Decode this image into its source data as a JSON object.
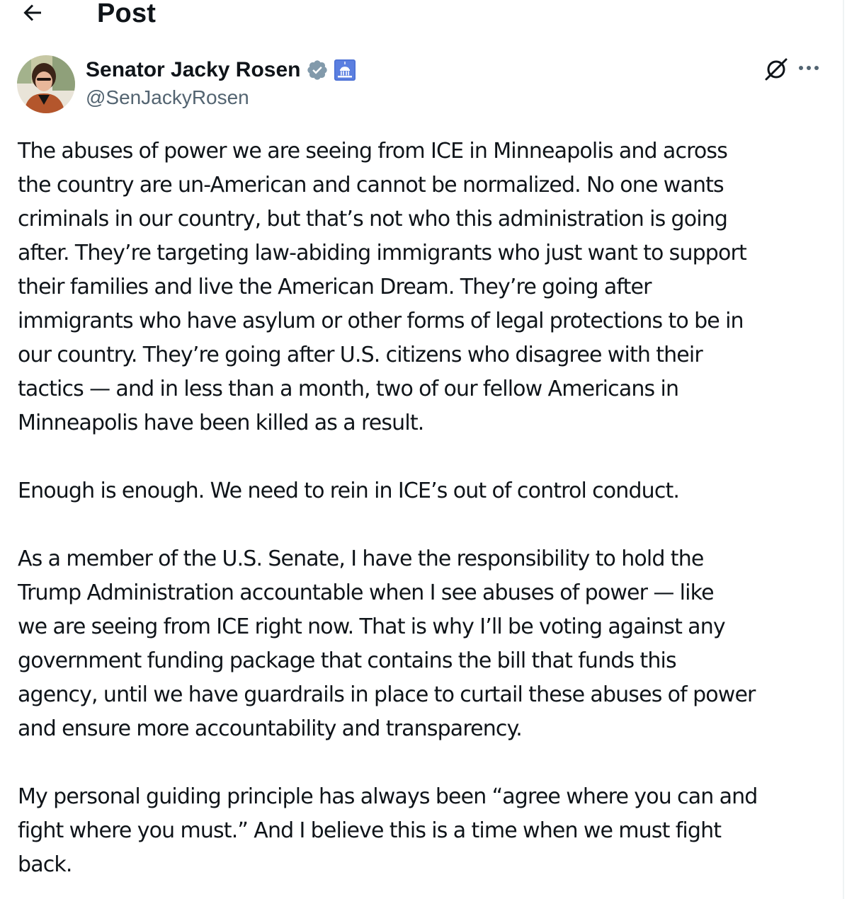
{
  "header": {
    "title": "Post",
    "back_icon": "arrow-left-icon"
  },
  "author": {
    "display_name": "Senator Jacky Rosen",
    "handle": "@SenJackyRosen",
    "verified_icon": "verified-badge-icon",
    "verified_color": "#829aab",
    "affiliation_icon": "us-capitol-icon",
    "affiliation_color": "#4a6fd4",
    "avatar_icon": "profile-photo"
  },
  "actions": {
    "grok_icon": "grok-icon",
    "more_icon": "more-horizontal-icon"
  },
  "post": {
    "paragraphs": [
      "The abuses of power we are seeing from ICE in Minneapolis and across\nthe country are un-American and cannot be normalized. No one wants\ncriminals in our country, but that’s not who this administration is going\nafter. They’re targeting law-abiding immigrants who just want to support\ntheir families and live the American Dream. They’re going after\nimmigrants who have asylum or other forms of legal protections to be in\nour country. They’re going after U.S. citizens who disagree with their\ntactics — and in less than a month, two of our fellow Americans in\nMinneapolis have been killed as a result.",
      "Enough is enough. We need to rein in ICE’s out of control conduct.",
      "As a member of the U.S. Senate, I have the responsibility to hold the\nTrump Administration accountable when I see abuses of power — like\nwe are seeing from ICE right now. That is why I’ll be voting against any\ngovernment funding package that contains the bill that funds this\nagency, until we have guardrails in place to curtail these abuses of power\nand ensure more accountability and transparency.",
      "My personal guiding principle has always been “agree where you can and\nfight where you must.” And I believe this is a time when we must fight\nback."
    ]
  }
}
